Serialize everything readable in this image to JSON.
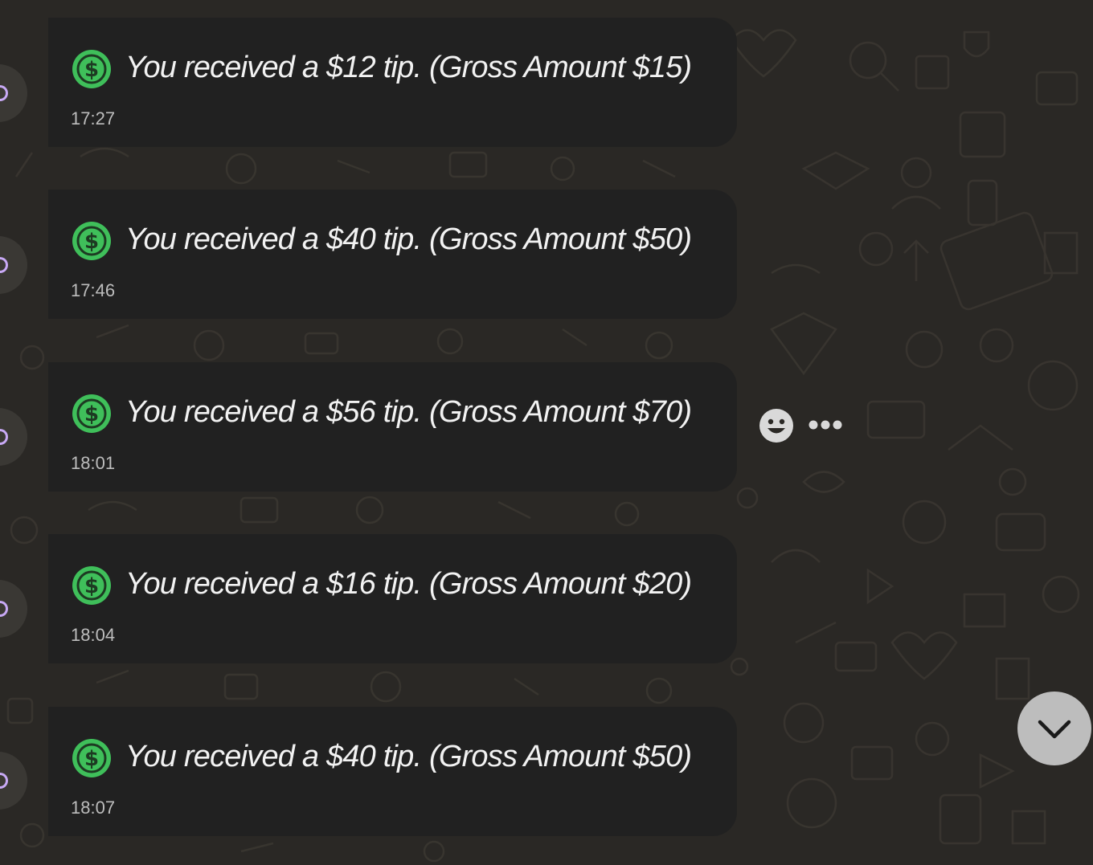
{
  "colors": {
    "background": "#2a2825",
    "bubble": "#212121",
    "coin_green": "#3fbf5a",
    "text": "#f2f2f2",
    "timestamp": "#bdbdbd",
    "scroll_button": "#bdbdbd"
  },
  "messages": [
    {
      "icon": "dollar-coin-icon",
      "text": "You received a $12 tip. (Gross Amount $15)",
      "time": "17:27"
    },
    {
      "icon": "dollar-coin-icon",
      "text": "You received a $40 tip. (Gross Amount $50)",
      "time": "17:46"
    },
    {
      "icon": "dollar-coin-icon",
      "text": "You received a $56 tip. (Gross Amount $70)",
      "time": "18:01"
    },
    {
      "icon": "dollar-coin-icon",
      "text": "You received a $16 tip. (Gross Amount $20)",
      "time": "18:04"
    },
    {
      "icon": "dollar-coin-icon",
      "text": "You received a $40 tip. (Gross Amount $50)",
      "time": "18:07"
    }
  ],
  "hover_actions": {
    "react_icon": "smiley-icon",
    "more_icon": "more-dots-icon"
  },
  "scroll_down_icon": "chevron-down-icon"
}
